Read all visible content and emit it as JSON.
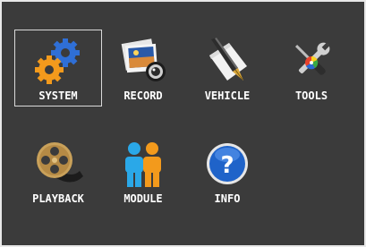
{
  "menu": {
    "items": [
      {
        "label": "SYSTEM",
        "icon": "gears-icon",
        "selected": true
      },
      {
        "label": "RECORD",
        "icon": "photo-camera-icon",
        "selected": false
      },
      {
        "label": "VEHICLE",
        "icon": "fountain-pen-icon",
        "selected": false
      },
      {
        "label": "TOOLS",
        "icon": "wrench-screwdriver-icon",
        "selected": false
      },
      {
        "label": "PLAYBACK",
        "icon": "film-reel-icon",
        "selected": false
      },
      {
        "label": "MODULE",
        "icon": "people-icon",
        "selected": false
      },
      {
        "label": "INFO",
        "icon": "info-question-icon",
        "selected": false
      }
    ]
  },
  "colors": {
    "background": "#3b3b3b",
    "label": "#ffffff",
    "selection_border": "#d9d9d9"
  }
}
